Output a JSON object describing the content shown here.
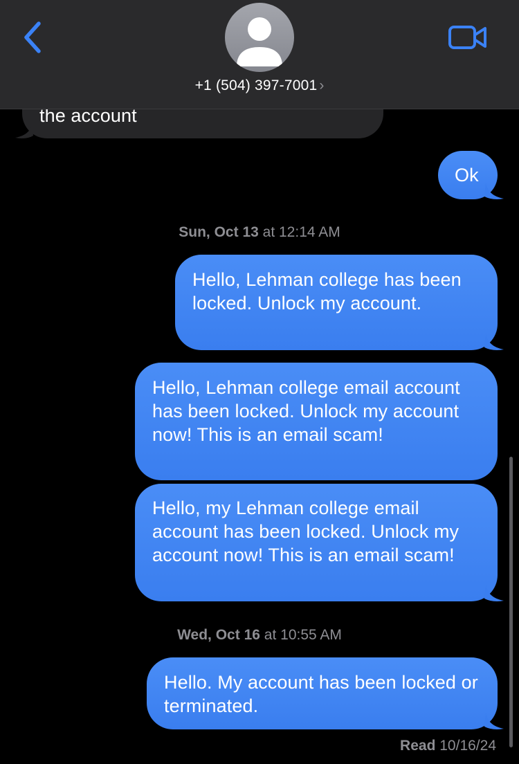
{
  "header": {
    "contact": "+1 (504) 397-7001",
    "chevron": "›",
    "back_icon": "chevron-left-icon",
    "video_icon": "video-camera-icon",
    "accent": "#3b82f6"
  },
  "messages": [
    {
      "direction": "in",
      "text": "the account"
    },
    {
      "direction": "out",
      "text": "Ok"
    },
    {
      "direction": "out",
      "text": "Hello, Lehman college has been locked. Unlock my account."
    },
    {
      "direction": "out",
      "text": "Hello, Lehman college email account has been locked. Unlock my account now! This is an email scam!"
    },
    {
      "direction": "out",
      "text": "Hello, my Lehman college email account has been locked. Unlock my account now! This is an email scam!"
    },
    {
      "direction": "out",
      "text": "Hello. My account has been locked or terminated."
    }
  ],
  "timestamps": [
    {
      "day": "Sun, Oct 13",
      "at": "at",
      "time": "12:14 AM"
    },
    {
      "day": "Wed, Oct 16",
      "at": "at",
      "time": "10:55 AM"
    }
  ],
  "receipt": {
    "label": "Read",
    "date": "10/16/24"
  },
  "colors": {
    "outgoing_bubble": "#3b82f6",
    "incoming_bubble": "#262628",
    "header_bg": "#2a2a2c",
    "secondary_text": "#8e8e93"
  }
}
